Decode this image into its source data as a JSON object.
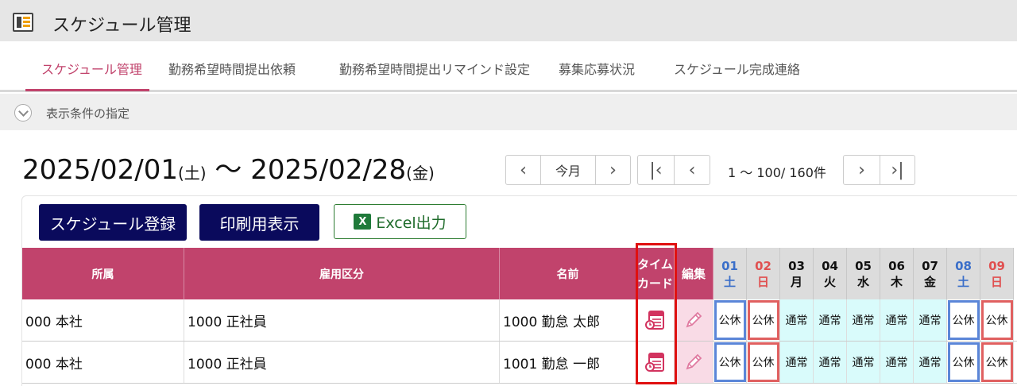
{
  "app": {
    "title": "スケジュール管理"
  },
  "tabs": [
    {
      "label": "スケジュール管理",
      "active": true
    },
    {
      "label": "勤務希望時間提出依頼"
    },
    {
      "label": "勤務希望時間提出リマインド設定"
    },
    {
      "label": "募集応募状況"
    },
    {
      "label": "スケジュール完成連絡"
    }
  ],
  "filter": {
    "label": "表示条件の指定"
  },
  "period": {
    "start_date": "2025/02/01",
    "start_wd": "(土)",
    "sep": "～",
    "end_date": "2025/02/28",
    "end_wd": "(金)"
  },
  "month_nav": {
    "today_label": "今月"
  },
  "paging": {
    "count_text": "1 ～ 100/ 160件"
  },
  "actions": {
    "register": "スケジュール登録",
    "print": "印刷用表示",
    "excel": "Excel出力",
    "excel_icon": "X"
  },
  "table": {
    "headers": {
      "affiliation": "所属",
      "employment": "雇用区分",
      "name": "名前",
      "timecard_1": "タイム",
      "timecard_2": "カード",
      "edit": "編集"
    },
    "days": [
      {
        "d": "01",
        "w": "土",
        "color": "blue"
      },
      {
        "d": "02",
        "w": "日",
        "color": "red"
      },
      {
        "d": "03",
        "w": "月"
      },
      {
        "d": "04",
        "w": "火"
      },
      {
        "d": "05",
        "w": "水"
      },
      {
        "d": "06",
        "w": "木"
      },
      {
        "d": "07",
        "w": "金"
      },
      {
        "d": "08",
        "w": "土",
        "color": "blue"
      },
      {
        "d": "09",
        "w": "日",
        "color": "red"
      }
    ],
    "rows": [
      {
        "affiliation": "000 本社",
        "employment": "1000 正社員",
        "name": "1000 勤怠 太郎",
        "shifts": [
          "公休",
          "公休",
          "通常",
          "通常",
          "通常",
          "通常",
          "通常",
          "公休",
          "公休"
        ]
      },
      {
        "affiliation": "000 本社",
        "employment": "1000 正社員",
        "name": "1001 勤怠 一郎",
        "shifts": [
          "公休",
          "公休",
          "通常",
          "通常",
          "通常",
          "通常",
          "通常",
          "公休",
          "公休"
        ]
      }
    ]
  },
  "colors": {
    "header_bg": "#c1436c",
    "primary_button": "#0a0a5c",
    "excel_green": "#1f7a3a",
    "normal_shift_bg": "#d9fbfb",
    "highlight_box": "#e01010"
  }
}
